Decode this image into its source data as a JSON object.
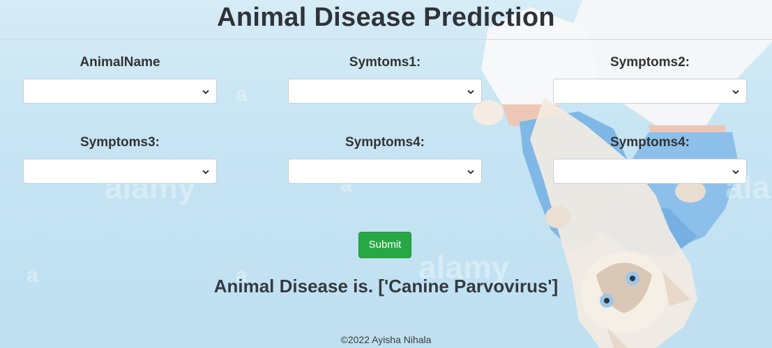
{
  "header": {
    "title": "Animal Disease Prediction"
  },
  "form": {
    "fields": [
      {
        "label": "AnimalName",
        "value": ""
      },
      {
        "label": "Symtoms1:",
        "value": ""
      },
      {
        "label": "Symptoms2:",
        "value": ""
      },
      {
        "label": "Symptoms3:",
        "value": ""
      },
      {
        "label": "Symptoms4:",
        "value": ""
      },
      {
        "label": "Symptoms4:",
        "value": ""
      }
    ],
    "submit_label": "Submit"
  },
  "result": {
    "text": "Animal Disease is. ['Canine Parvovirus']"
  },
  "footer": {
    "text": "©2022 Ayisha Nihala"
  },
  "colors": {
    "submit_button": "#28a745",
    "background": "#c6e4f3"
  }
}
